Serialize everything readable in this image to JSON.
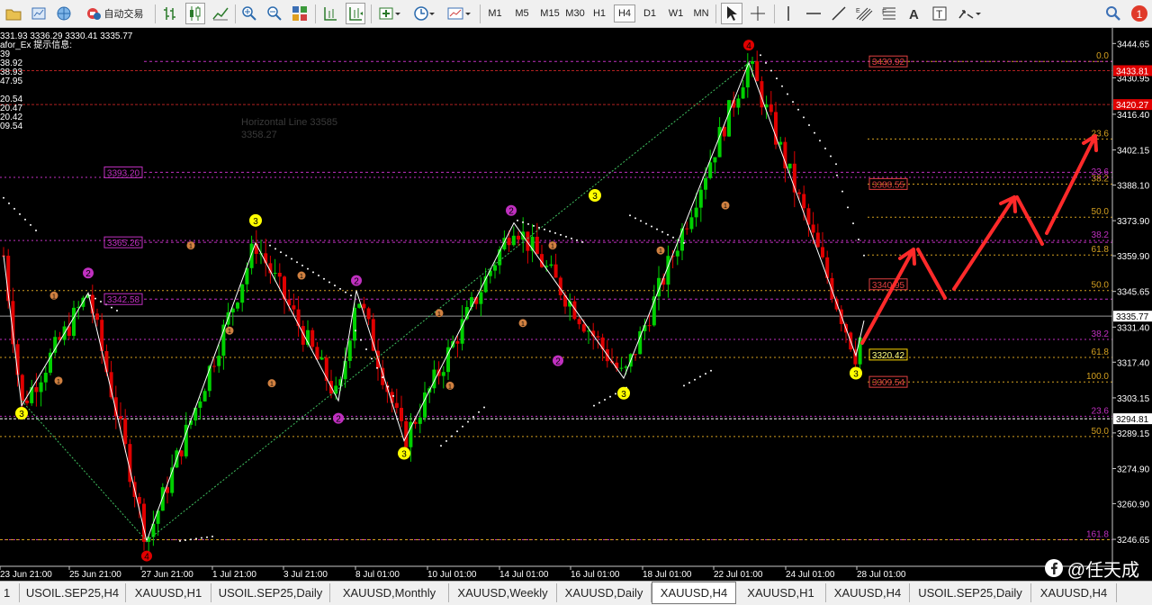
{
  "toolbar": {
    "auto_trade_label": "自动交易",
    "timeframes": [
      "M1",
      "M5",
      "M15",
      "M30",
      "H1",
      "H4",
      "D1",
      "W1",
      "MN"
    ],
    "active_timeframe": "H4"
  },
  "chart_data": {
    "type": "candlestick",
    "symbol": "XAUUSD",
    "timeframe": "H4",
    "info_lines": [
      "331.93 3336.29 3330.41 3335.77",
      "afor_Ex 提示信息:",
      "39",
      "38.92",
      "38.93",
      "47.95",
      "",
      "20.54",
      "20.47",
      "20.42",
      "09.54"
    ],
    "current_price": "3335.77",
    "price_axis": [
      "3444.65",
      "3430.95",
      "3416.40",
      "3402.15",
      "3388.10",
      "3373.90",
      "3359.90",
      "3345.65",
      "3331.40",
      "3317.40",
      "3303.15",
      "3289.15",
      "3274.90",
      "3260.90",
      "3246.65"
    ],
    "y_range": [
      3242,
      3448
    ],
    "axis_markers": [
      {
        "label": "3433.81",
        "price": 3433.81,
        "color": "#e00000"
      },
      {
        "label": "3420.27",
        "price": 3420.27,
        "color": "#e00000"
      },
      {
        "label": "3335.77",
        "price": 3335.77,
        "color": "#ffffff"
      },
      {
        "label": "3294.81",
        "price": 3294.81,
        "color": "#ffffff"
      }
    ],
    "time_axis": [
      "23 Jun 21:00",
      "25 Jun 21:00",
      "27 Jun 21:00",
      "1 Jul 21:00",
      "3 Jul 21:00",
      "8 Jul 01:00",
      "10 Jul 01:00",
      "14 Jul 01:00",
      "16 Jul 01:00",
      "18 Jul 01:00",
      "22 Jul 01:00",
      "24 Jul 01:00",
      "28 Jul 01:00"
    ],
    "price_boxes": [
      {
        "label": "3393.20",
        "price": 3393.2,
        "color": "#c030c0"
      },
      {
        "label": "3365.26",
        "price": 3365.26,
        "color": "#c030c0"
      },
      {
        "label": "3342.58",
        "price": 3342.58,
        "color": "#c030c0"
      },
      {
        "label": "3430.92",
        "price": 3437.5,
        "color": "#e04040"
      },
      {
        "label": "3388.55",
        "price": 3388.55,
        "color": "#e04040"
      },
      {
        "label": "3340.95",
        "price": 3348.5,
        "color": "#e04040"
      },
      {
        "label": "3320.42",
        "price": 3320.42,
        "color": "#ffd700"
      },
      {
        "label": "3309.54",
        "price": 3309.54,
        "color": "#e04040"
      }
    ],
    "fib_levels": [
      {
        "label": "0.0",
        "price": 3437.5
      },
      {
        "label": "23.6",
        "price": 3406.5
      },
      {
        "label": "38.2",
        "price": 3388.5
      },
      {
        "label": "50.0",
        "price": 3375.3
      },
      {
        "label": "61.8",
        "price": 3360.2
      },
      {
        "label": "100.0",
        "price": 3309.5
      }
    ],
    "fib_levels_2": [
      {
        "label": "23.6",
        "price": 3391.2
      },
      {
        "label": "38.2",
        "price": 3366.0
      },
      {
        "label": "50.0",
        "price": 3346.0
      },
      {
        "label": "38.2",
        "price": 3326.5
      },
      {
        "label": "61.8",
        "price": 3319.3
      },
      {
        "label": "23.6",
        "price": 3295.8
      },
      {
        "label": "50.0",
        "price": 3287.7
      },
      {
        "label": "161.8",
        "price": 3246.5
      }
    ],
    "wave_labels": [
      {
        "text": "2",
        "color": "#c030c0"
      },
      {
        "text": "3",
        "color": "#ffff00"
      },
      {
        "text": "4",
        "color": "#e00000"
      },
      {
        "text": "1",
        "color": "#d08040"
      }
    ],
    "hline_label": "Horizontal Line 33585",
    "hline_label_2": "3358.27"
  },
  "tabs": [
    "USOIL.SEP25,H4",
    "XAUUSD,H1",
    "USOIL.SEP25,Daily",
    "XAUUSD,Monthly",
    "XAUUSD,Weekly",
    "XAUUSD,Daily",
    "XAUUSD,H4",
    "XAUUSD,H1",
    "XAUUSD,H4",
    "USOIL.SEP25,Daily",
    "XAUUSD,H4"
  ],
  "active_tab_index": 6,
  "left_tab_fragment": "1",
  "watermark": "@任天成",
  "notification_count": "1"
}
